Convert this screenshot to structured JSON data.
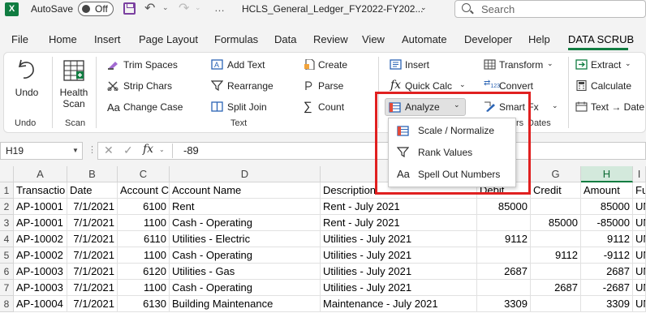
{
  "title_bar": {
    "app_logo": "X",
    "autosave_label": "AutoSave",
    "autosave_state": "Off",
    "doc_title": "HCLS_General_Ledger_FY2022-FY202...",
    "search_placeholder": "Search"
  },
  "tabs": [
    "File",
    "Home",
    "Insert",
    "Page Layout",
    "Formulas",
    "Data",
    "Review",
    "View",
    "Automate",
    "Developer",
    "Help",
    "DATA SCRUB"
  ],
  "active_tab": "DATA SCRUB",
  "ribbon": {
    "undo": {
      "label": "Undo",
      "group": "Undo"
    },
    "scan": {
      "label_line1": "Health",
      "label_line2": "Scan",
      "group": "Scan"
    },
    "text_group": {
      "label": "Text",
      "col1": [
        "Trim Spaces",
        "Strip Chars",
        "Change Case"
      ],
      "col2": [
        "Add Text",
        "Rearrange",
        "Split  Join"
      ],
      "col3": [
        "Create",
        "Parse",
        "Count"
      ]
    },
    "numbers_group": {
      "label_partial": "rs",
      "items": [
        "Insert",
        "Quick Calc",
        "Analyze"
      ]
    },
    "convert_group": {
      "label_partial": "Dates",
      "items": [
        "Transform",
        "Convert",
        "Smart Fx"
      ]
    },
    "last_group": {
      "items": [
        "Extract",
        "Calculate",
        "Text → Date"
      ]
    }
  },
  "analyze_menu": {
    "items": [
      {
        "label": "Scale / Normalize",
        "icon": "scale-icon"
      },
      {
        "label": "Rank Values",
        "icon": "funnel-icon"
      },
      {
        "label": "Spell Out Numbers",
        "icon": "aa-icon"
      }
    ]
  },
  "formula_bar": {
    "name_box": "H19",
    "value": "-89"
  },
  "sheet": {
    "columns": [
      "A",
      "B",
      "C",
      "D",
      "E",
      "F",
      "G",
      "H",
      "I"
    ],
    "selected_column": "H",
    "row_numbers": [
      "1",
      "2",
      "3",
      "4",
      "5",
      "6",
      "7",
      "8"
    ],
    "rows": [
      [
        "Transactio",
        "Date",
        "Account C",
        "Account Name",
        "Description",
        "Debit",
        "Credit",
        "Amount",
        "Fu"
      ],
      [
        "AP-10001",
        "7/1/2021",
        "6100",
        "Rent",
        "Rent - July 2021",
        "85000",
        "",
        "85000",
        "UN"
      ],
      [
        "AP-10001",
        "7/1/2021",
        "1100",
        "Cash - Operating",
        "Rent - July 2021",
        "",
        "85000",
        "-85000",
        "UN"
      ],
      [
        "AP-10002",
        "7/1/2021",
        "6110",
        "Utilities - Electric",
        "Utilities - July 2021",
        "9112",
        "",
        "9112",
        "UN"
      ],
      [
        "AP-10002",
        "7/1/2021",
        "1100",
        "Cash - Operating",
        "Utilities - July 2021",
        "",
        "9112",
        "-9112",
        "UN"
      ],
      [
        "AP-10003",
        "7/1/2021",
        "6120",
        "Utilities - Gas",
        "Utilities - July 2021",
        "2687",
        "",
        "2687",
        "UN"
      ],
      [
        "AP-10003",
        "7/1/2021",
        "1100",
        "Cash - Operating",
        "Utilities - July 2021",
        "",
        "2687",
        "-2687",
        "UN"
      ],
      [
        "AP-10004",
        "7/1/2021",
        "6130",
        "Building Maintenance",
        "Maintenance - July 2021",
        "3309",
        "",
        "3309",
        "UN"
      ]
    ]
  },
  "colors": {
    "excel_green": "#107c41",
    "highlight_red": "#e02020"
  }
}
